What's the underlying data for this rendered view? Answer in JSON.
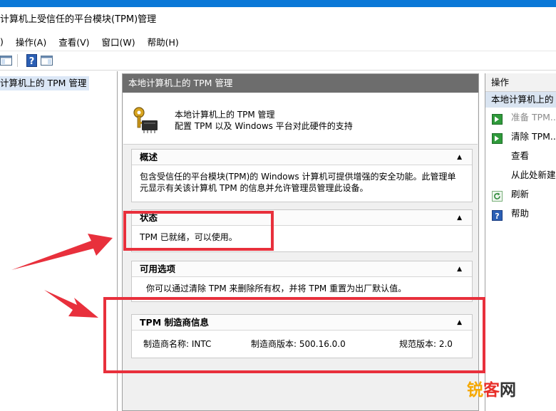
{
  "window": {
    "title": "计算机上受信任的平台模块(TPM)管理"
  },
  "menu": {
    "file_fragment": ")",
    "action": "操作(A)",
    "view": "查看(V)",
    "window": "窗口(W)",
    "help": "帮助(H)"
  },
  "toolbar": {
    "icons": [
      "console-icon",
      "help-icon",
      "show-hide-pane-icon"
    ]
  },
  "tree": {
    "selected_item": "计算机上的 TPM 管理"
  },
  "main": {
    "header": "本地计算机上的 TPM 管理",
    "intro_title": "本地计算机上的 TPM 管理",
    "intro_desc": "配置 TPM 以及 Windows 平台对此硬件的支持",
    "sections": [
      {
        "title": "概述",
        "body": "包含受信任的平台模块(TPM)的 Windows 计算机可提供增强的安全功能。此管理单元显示有关该计算机 TPM 的信息并允许管理员管理此设备。"
      },
      {
        "title": "状态",
        "body": "TPM 已就绪，可以使用。"
      },
      {
        "title": "可用选项",
        "body": "你可以通过清除 TPM 来删除所有权，并将 TPM 重置为出厂默认值。"
      },
      {
        "title": "TPM 制造商信息",
        "manufacturer_name": "制造商名称: INTC",
        "manufacturer_version": "制造商版本: 500.16.0.0",
        "spec_version": "规范版本: 2.0"
      }
    ]
  },
  "actions_pane": {
    "title": "操作",
    "group": "本地计算机上的",
    "items": [
      {
        "label": "准备 TPM...",
        "icon": "green-arrow-icon",
        "enabled": false
      },
      {
        "label": "清除 TPM...",
        "icon": "green-arrow-icon",
        "enabled": true
      },
      {
        "label": "查看",
        "icon": "",
        "enabled": true
      },
      {
        "label": "从此处新建",
        "icon": "",
        "enabled": true
      },
      {
        "label": "刷新",
        "icon": "refresh-icon",
        "enabled": true
      },
      {
        "label": "帮助",
        "icon": "help-icon",
        "enabled": true
      }
    ]
  },
  "watermark": {
    "part1": "锐",
    "part2": "客",
    "part3": "网"
  },
  "colors": {
    "annotation_red": "#e8303c",
    "accent_blue": "#0a78d7",
    "header_gray": "#6d6d6d"
  }
}
